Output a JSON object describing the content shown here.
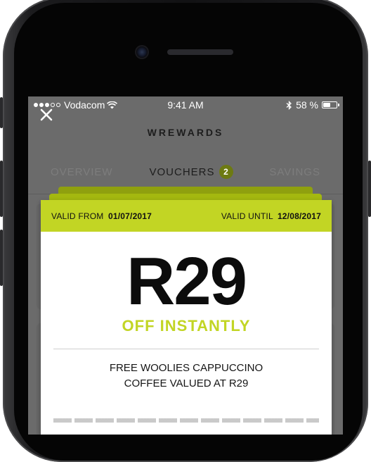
{
  "status_bar": {
    "carrier": "Vodacom",
    "time": "9:41 AM",
    "battery": "58 %",
    "battery_fraction": 0.58
  },
  "header": {
    "title": "WREWARDS"
  },
  "tabs": [
    {
      "label": "OVERVIEW",
      "active": false
    },
    {
      "label": "VOUCHERS",
      "active": true,
      "badge": "2"
    },
    {
      "label": "SAVINGS",
      "active": false
    }
  ],
  "voucher": {
    "valid_from_label": "VALID FROM",
    "valid_from_date": "01/07/2017",
    "valid_until_label": "VALID UNTIL",
    "valid_until_date": "12/08/2017",
    "amount": "R29",
    "amount_subtitle": "OFF INSTANTLY",
    "description_line1": "FREE WOOLIES CAPPUCCINO",
    "description_line2": "COFFEE VALUED AT R29"
  },
  "colors": {
    "accent": "#c2d524",
    "badge": "#6d7a12",
    "overlay": "#6b6b6b"
  },
  "icons": [
    "close-icon",
    "wifi-icon",
    "bluetooth-icon",
    "battery-icon",
    "signal-dots-icon"
  ]
}
